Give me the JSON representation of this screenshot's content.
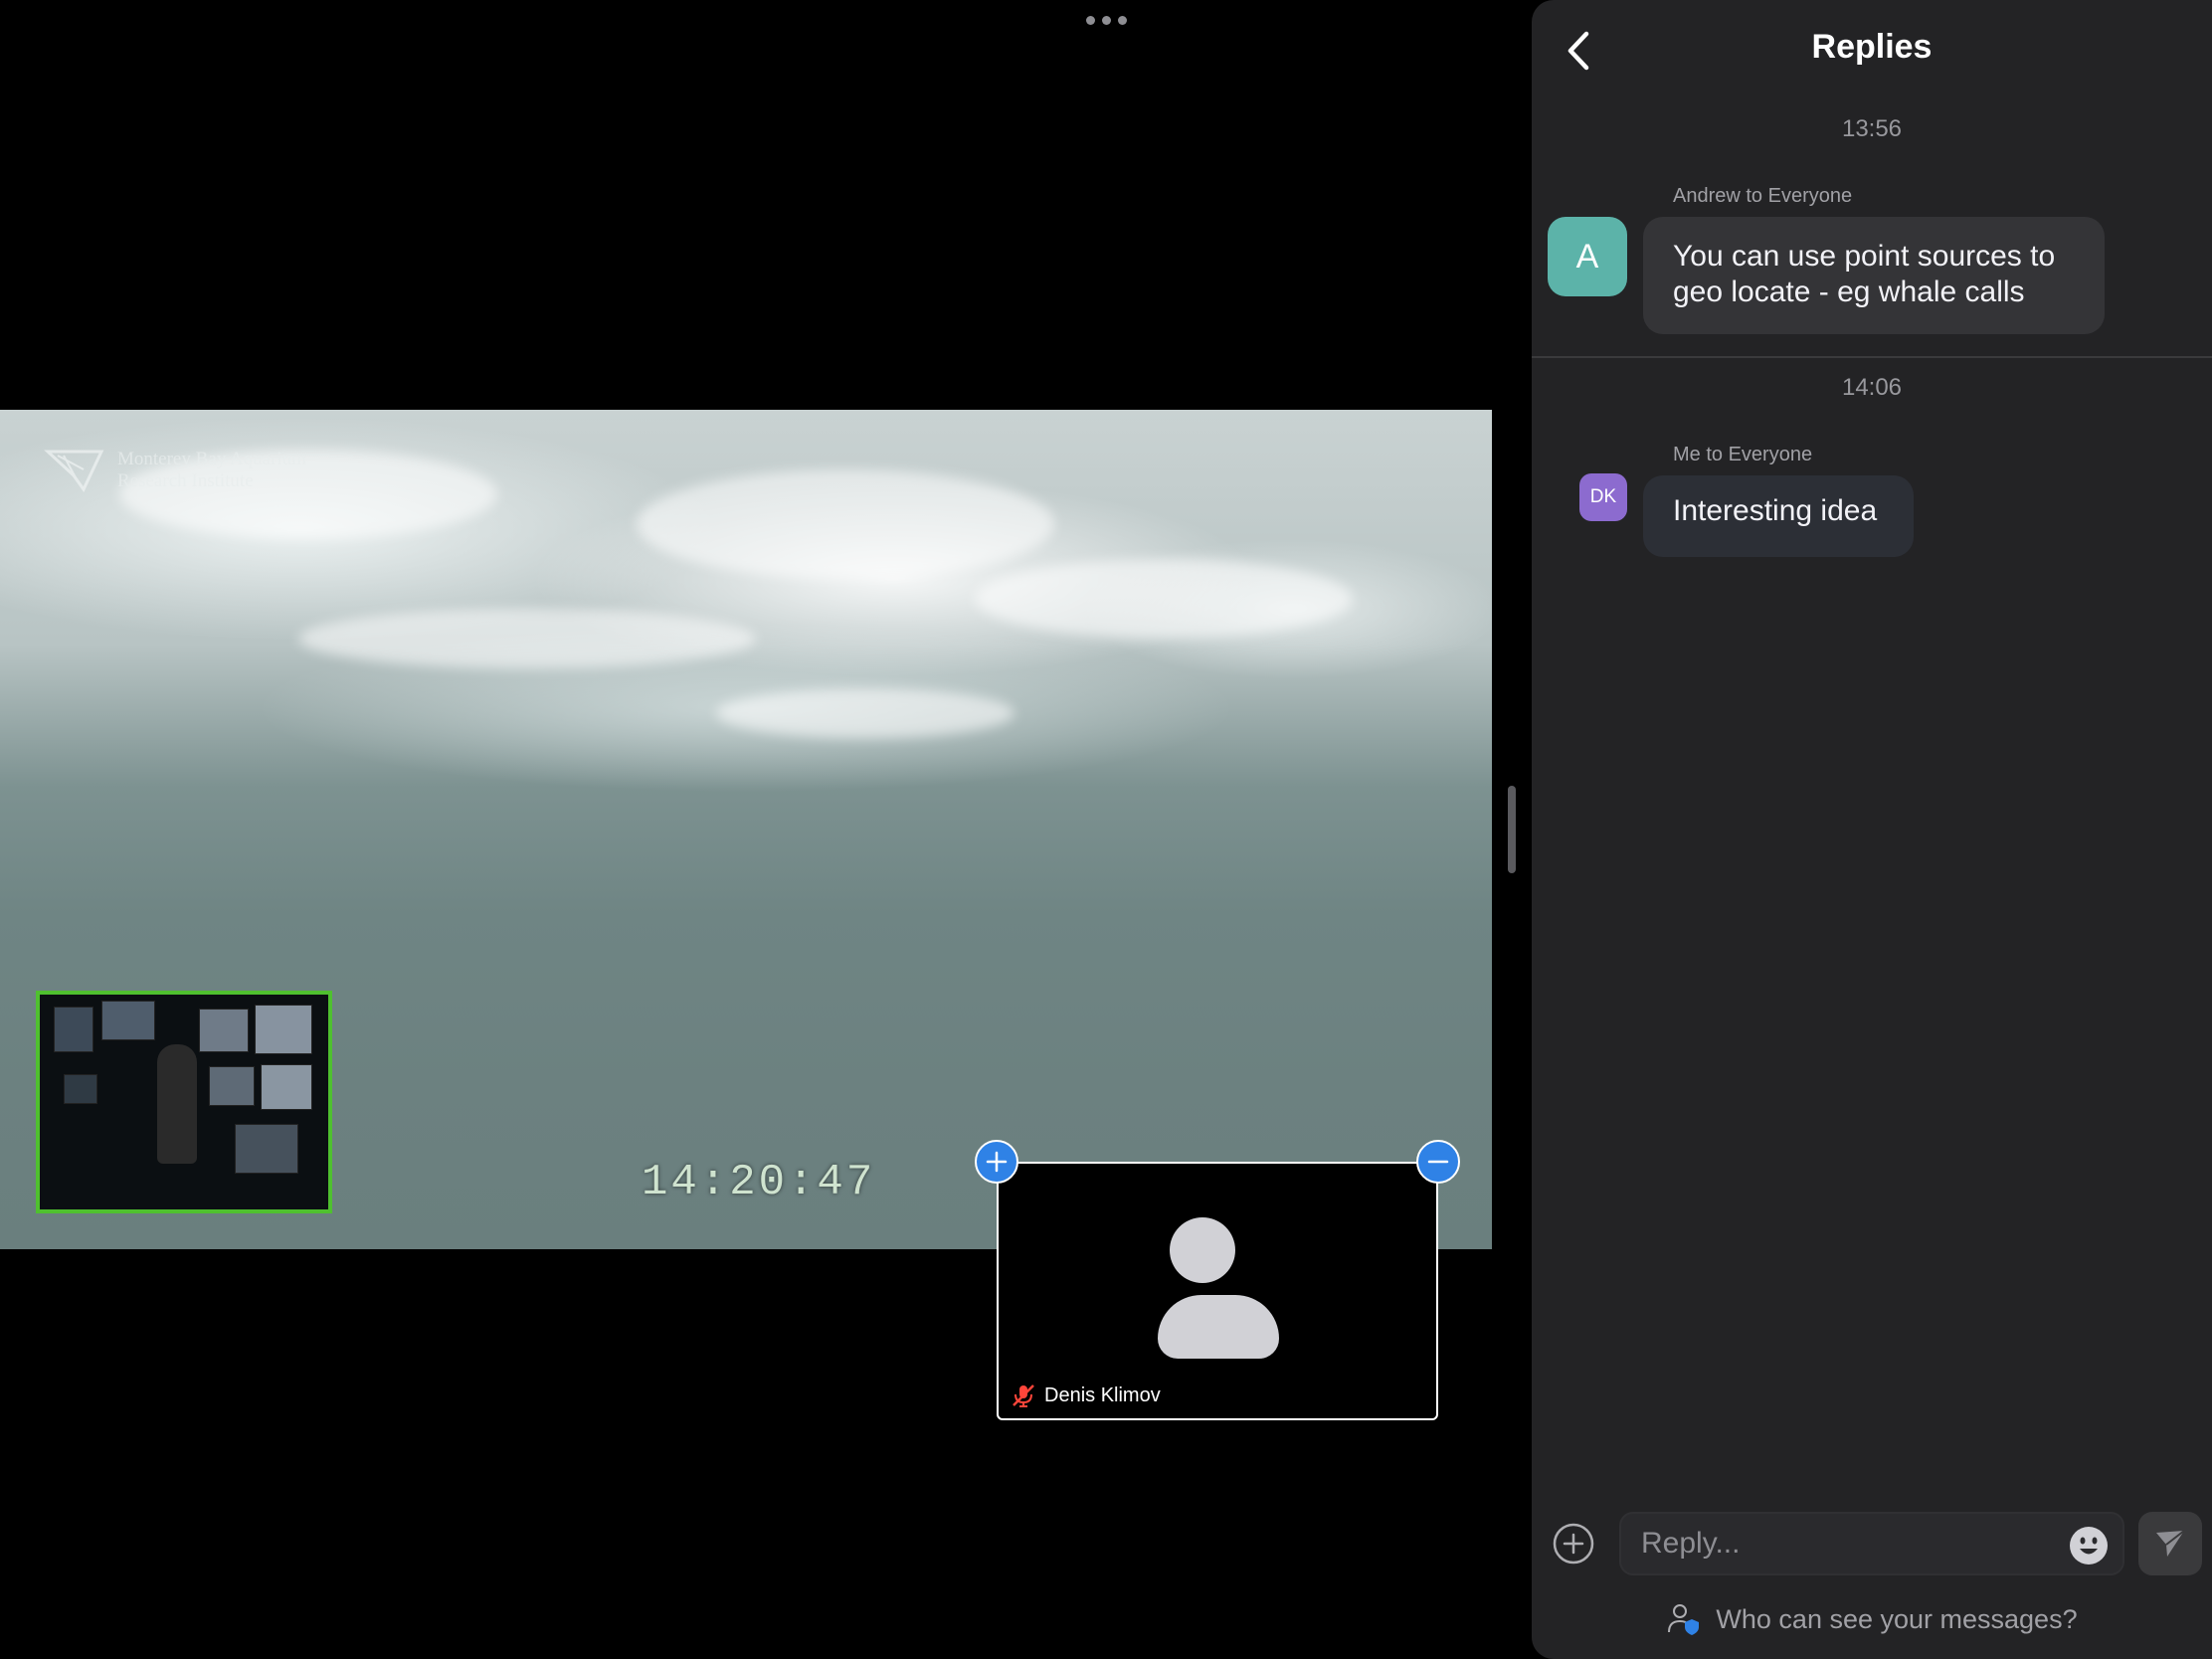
{
  "video": {
    "more_icon": "more-dots-icon",
    "logo_line1": "Monterey Bay Aquarium",
    "logo_line2": "Research Institute",
    "timestamp": "14:20:47",
    "participant": {
      "name": "Denis Klimov",
      "muted_icon": "mic-muted-icon",
      "mute_color": "#ff453a"
    },
    "pip_border_color": "#4fc02f",
    "zoom_in_icon": "plus-icon",
    "zoom_out_icon": "minus-icon"
  },
  "panel": {
    "title": "Replies",
    "back_icon": "chevron-left-icon",
    "threads": [
      {
        "time": "13:56",
        "sender": "Andrew to Everyone",
        "avatar_initial": "A",
        "avatar_color": "#5cb3a9",
        "message_line1": "You can use point sources to",
        "message_line2": "geo locate - eg whale calls"
      },
      {
        "time": "14:06",
        "sender": "Me to Everyone",
        "avatar_initial": "DK",
        "avatar_color": "#8c6bcf",
        "message": "Interesting idea"
      }
    ],
    "composer": {
      "placeholder": "Reply...",
      "add_icon": "plus-circle-icon",
      "emoji_icon": "emoji-icon",
      "send_icon": "send-icon"
    },
    "who_can_see": "Who can see your messages?"
  }
}
